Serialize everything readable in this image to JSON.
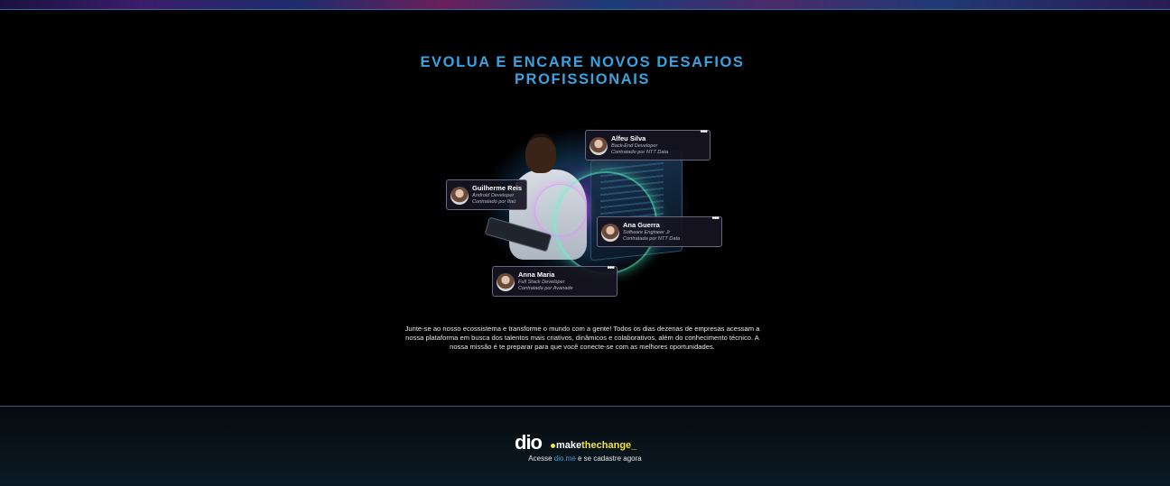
{
  "section": {
    "headline": "EVOLUA E ENCARE NOVOS DESAFIOS PROFISSIONAIS",
    "description": "Junte-se ao nosso ecossistema e transforme o mundo com a gente! Todos os dias dezenas de empresas acessam a nossa plataforma em busca dos talentos mais criativos, dinâmicos e colaborativos, além do conhecimento técnico. A nossa missão é te preparar para que você conecte-se com as melhores oportunidades."
  },
  "profiles": [
    {
      "name": "Alfeu Silva",
      "role": "Back-End Developer",
      "hired_by": "Contratado por NTT Data",
      "menu": "•••"
    },
    {
      "name": "Guilherme Reis",
      "role": "Android Developer",
      "hired_by": "Contratado por Itaú",
      "menu": ""
    },
    {
      "name": "Ana Guerra",
      "role": "Software Engineer Jr",
      "hired_by": "Contratada por NTT Data",
      "menu": "•••"
    },
    {
      "name": "Anna Maria",
      "role": "Full Stack Developer",
      "hired_by": "Contratada por Avanade",
      "menu": "•••"
    }
  ],
  "footer": {
    "logo_dio": "dio",
    "logo_make": "make",
    "logo_the": "the",
    "logo_change": "change",
    "logo_underscore": "_",
    "cta_prefix": "Acesse ",
    "cta_link": "dio.me",
    "cta_suffix": " e se cadastre agora"
  },
  "colors": {
    "accent": "#3aa3df",
    "brand_yellow": "#f4e33a",
    "background": "#000000"
  }
}
